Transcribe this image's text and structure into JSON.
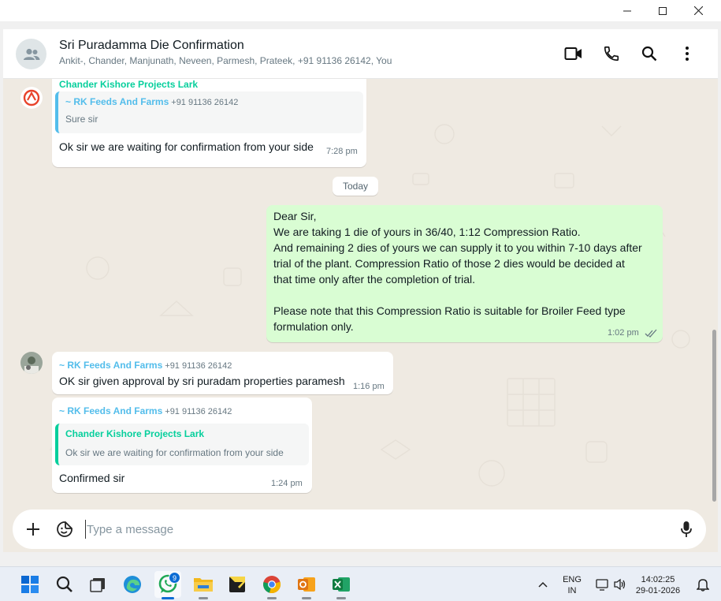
{
  "chat_header": {
    "title": "Sri Puradamma Die Confirmation",
    "members": "Ankit-, Chander, Manjunath, Neveen, Parmesh, Prateek, +91 91136 26142, You"
  },
  "messages": {
    "m1": {
      "sender": "Chander Kishore Projects Lark",
      "sender_color": "#06cf9c",
      "quote_sender": "~ RK Feeds And Farms",
      "quote_phone": "+91 91136 26142",
      "quote_text": "Sure sir",
      "text": "Ok sir we are waiting for confirmation from your side",
      "time": "7:28 pm"
    },
    "day_label": "Today",
    "m2": {
      "lines": [
        "Dear Sir,",
        "We are taking 1 die of yours in 36/40, 1:12 Compression Ratio.",
        "And remaining 2 dies of yours we can supply it to you within 7-10 days after",
        "trial of the plant. Compression Ratio of those 2 dies would be decided at",
        "that time only after the completion of trial.",
        "",
        "Please note that this Compression Ratio is suitable for Broiler Feed type",
        "formulation only."
      ],
      "time": "1:02 pm"
    },
    "m3": {
      "sender": "~ RK Feeds And Farms",
      "phone": "+91 91136 26142",
      "text": "OK sir given approval by sri puradam properties paramesh",
      "time": "1:16 pm"
    },
    "m4": {
      "sender": "~ RK Feeds And Farms",
      "phone": "+91 91136 26142",
      "quote_sender": "Chander Kishore Projects Lark",
      "quote_text": "Ok sir we are waiting for confirmation from your side",
      "text": "Confirmed sir",
      "time": "1:24 pm"
    }
  },
  "composer": {
    "placeholder": "Type a message"
  },
  "taskbar": {
    "whatsapp_badge": "9",
    "lang_line1": "ENG",
    "lang_line2": "IN",
    "time": "14:02:25",
    "date": "29-01-2026"
  },
  "colors": {
    "sender_blue": "#53bdeb",
    "sender_green": "#06cf9c",
    "outgoing_bubble": "#d9fdd3",
    "chat_bg": "#efeae2"
  }
}
